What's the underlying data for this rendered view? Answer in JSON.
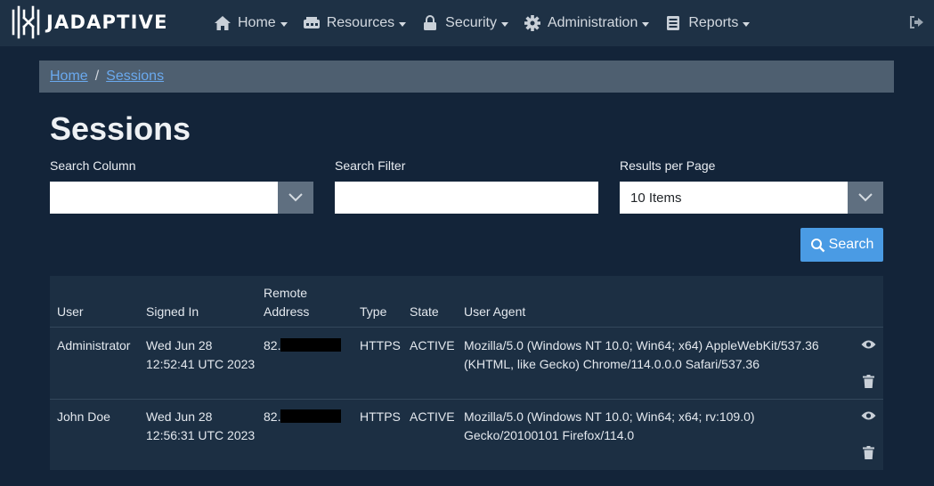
{
  "brand": {
    "name": "JADAPTIVE"
  },
  "nav": {
    "items": [
      {
        "label": "Home",
        "icon": "home-icon"
      },
      {
        "label": "Resources",
        "icon": "server-icon"
      },
      {
        "label": "Security",
        "icon": "lock-icon"
      },
      {
        "label": "Administration",
        "icon": "gear-icon"
      },
      {
        "label": "Reports",
        "icon": "report-icon"
      }
    ],
    "logout_icon": "sign-out-icon"
  },
  "breadcrumb": {
    "home": "Home",
    "separator": "/",
    "current": "Sessions"
  },
  "page": {
    "title": "Sessions"
  },
  "filters": {
    "search_column_label": "Search Column",
    "search_column_value": "",
    "search_filter_label": "Search Filter",
    "search_filter_value": "",
    "results_label": "Results per Page",
    "results_value": "10 Items",
    "search_button": "Search"
  },
  "table": {
    "headers": {
      "user": "User",
      "signed_in": "Signed In",
      "remote_line1": "Remote",
      "remote_line2": "Address",
      "type": "Type",
      "state": "State",
      "user_agent": "User Agent"
    },
    "rows": [
      {
        "user": "Administrator",
        "signed_in_line1": "Wed Jun 28",
        "signed_in_line2": "12:52:41 UTC 2023",
        "remote": "82.",
        "type": "HTTPS",
        "state": "ACTIVE",
        "ua_line1": "Mozilla/5.0 (Windows NT 10.0; Win64; x64) AppleWebKit/537.36",
        "ua_line2": "(KHTML, like Gecko) Chrome/114.0.0.0 Safari/537.36"
      },
      {
        "user": "John Doe",
        "signed_in_line1": "Wed Jun 28",
        "signed_in_line2": "12:56:31 UTC 2023",
        "remote": "82.",
        "type": "HTTPS",
        "state": "ACTIVE",
        "ua_line1": "Mozilla/5.0 (Windows NT 10.0; Win64; x64; rv:109.0)",
        "ua_line2": "Gecko/20100101 Firefox/114.0"
      }
    ]
  },
  "colors": {
    "background": "#132439",
    "navbar": "#1e3145",
    "breadcrumb": "#4e5f70",
    "link": "#6aa9ee",
    "primary_button": "#4a9be4"
  }
}
